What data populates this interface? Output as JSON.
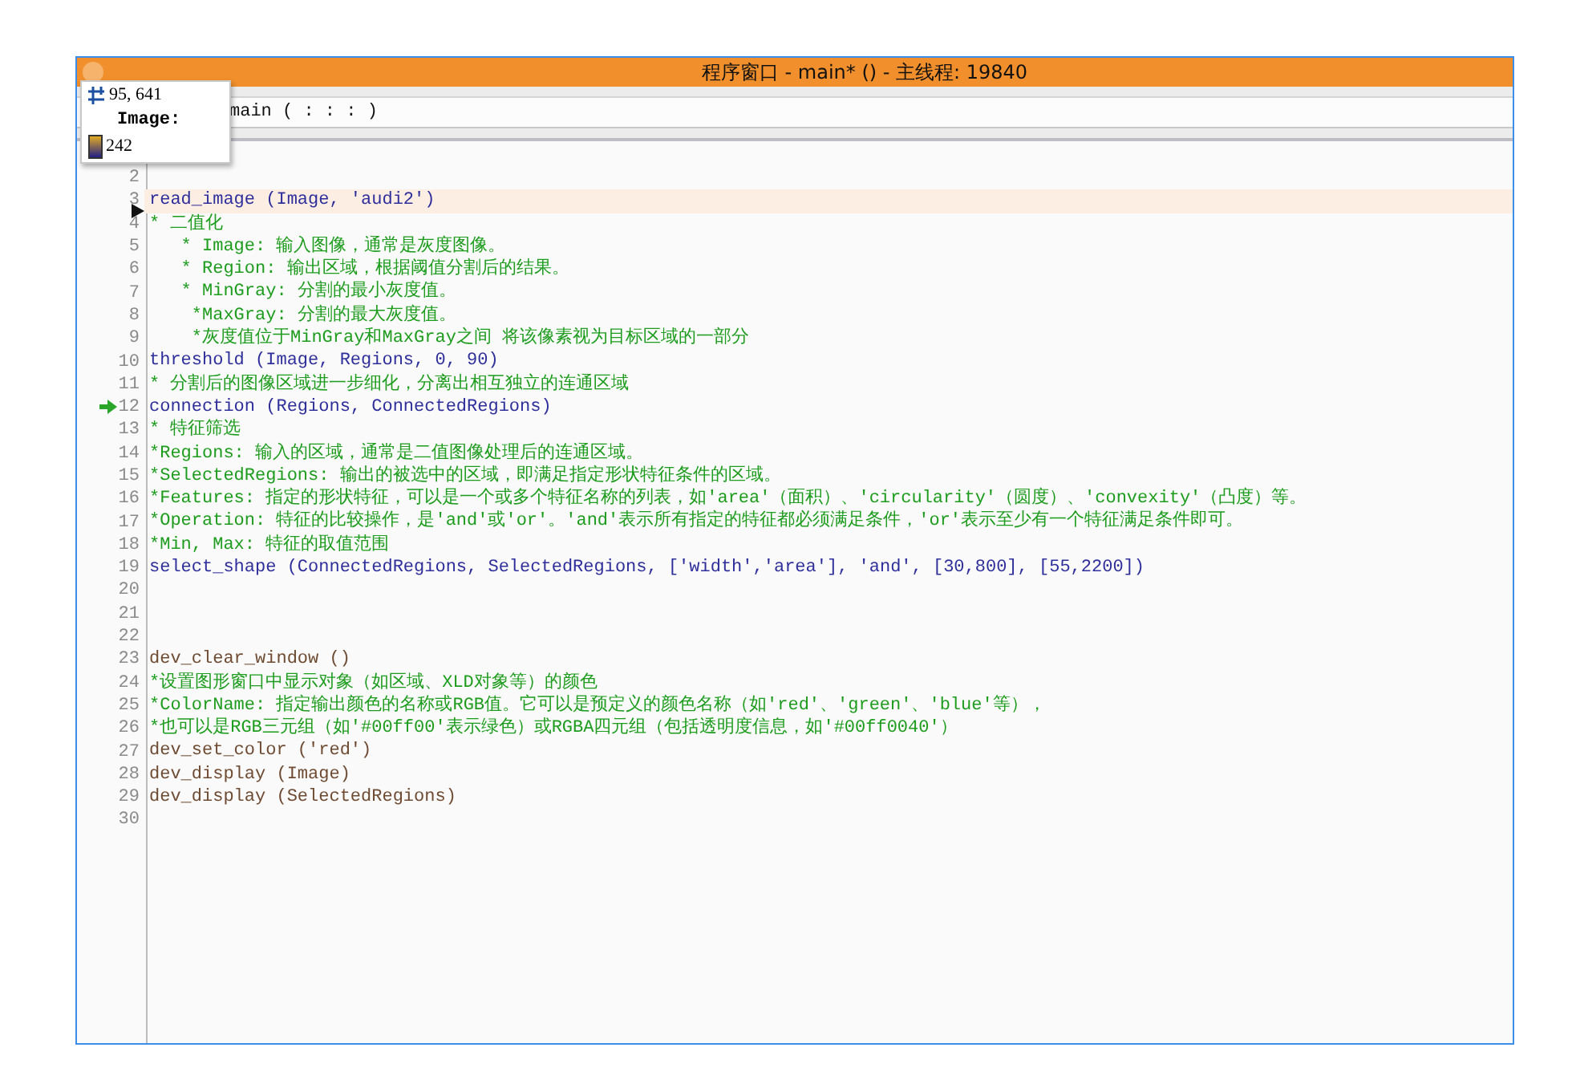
{
  "window": {
    "title": "程序窗口 - main* () - 主线程: 19840"
  },
  "procedure_header": "main ( : : : )",
  "tooltip": {
    "coords": "95, 641",
    "label": "Image:",
    "value": "242"
  },
  "lines": [
    {
      "number": "2",
      "kind": "code",
      "current": false
    },
    {
      "number": "3",
      "text": "read_image (Image, 'audi2')",
      "kind": "code",
      "current": true,
      "insert_cursor": true
    },
    {
      "number": "4",
      "text": "* 二值化",
      "kind": "comment",
      "current": false
    },
    {
      "number": "5",
      "text": "   * Image: 输入图像，通常是灰度图像。",
      "kind": "comment",
      "current": false
    },
    {
      "number": "6",
      "text": "   * Region: 输出区域，根据阈值分割后的结果。",
      "kind": "comment",
      "current": false
    },
    {
      "number": "7",
      "text": "   * MinGray: 分割的最小灰度值。",
      "kind": "comment",
      "current": false
    },
    {
      "number": "8",
      "text": "    *MaxGray: 分割的最大灰度值。",
      "kind": "comment",
      "current": false
    },
    {
      "number": "9",
      "text": "    *灰度值位于MinGray和MaxGray之间 将该像素视为目标区域的一部分",
      "kind": "comment",
      "current": false
    },
    {
      "number": "10",
      "text": "threshold (Image, Regions, 0, 90)",
      "kind": "code",
      "current": false
    },
    {
      "number": "11",
      "text": "* 分割后的图像区域进一步细化，分离出相互独立的连通区域",
      "kind": "comment",
      "current": false
    },
    {
      "number": "12",
      "text": "connection (Regions, ConnectedRegions)",
      "kind": "code",
      "current": false,
      "program_counter": true
    },
    {
      "number": "13",
      "text": "* 特征筛选",
      "kind": "comment",
      "current": false
    },
    {
      "number": "14",
      "text": "*Regions: 输入的区域，通常是二值图像处理后的连通区域。",
      "kind": "comment",
      "current": false
    },
    {
      "number": "15",
      "text": "*SelectedRegions: 输出的被选中的区域，即满足指定形状特征条件的区域。",
      "kind": "comment",
      "current": false
    },
    {
      "number": "16",
      "text": "*Features: 指定的形状特征，可以是一个或多个特征名称的列表，如'area'（面积）、'circularity'（圆度）、'convexity'（凸度）等。",
      "kind": "comment",
      "current": false
    },
    {
      "number": "17",
      "text": "*Operation: 特征的比较操作，是'and'或'or'。'and'表示所有指定的特征都必须满足条件，'or'表示至少有一个特征满足条件即可。",
      "kind": "comment",
      "current": false
    },
    {
      "number": "18",
      "text": "*Min, Max: 特征的取值范围",
      "kind": "comment",
      "current": false
    },
    {
      "number": "19",
      "text": "select_shape (ConnectedRegions, SelectedRegions, ['width','area'], 'and', [30,800], [55,2200])",
      "kind": "code",
      "current": false
    },
    {
      "number": "20",
      "kind": "code",
      "current": false
    },
    {
      "number": "21",
      "kind": "code",
      "current": false
    },
    {
      "number": "22",
      "kind": "code",
      "current": false
    },
    {
      "number": "23",
      "text": "dev_clear_window ()",
      "kind": "dev",
      "current": false
    },
    {
      "number": "24",
      "text": "*设置图形窗口中显示对象（如区域、XLD对象等）的颜色",
      "kind": "comment",
      "current": false
    },
    {
      "number": "25",
      "text": "*ColorName: 指定输出颜色的名称或RGB值。它可以是预定义的颜色名称（如'red'、'green'、'blue'等），",
      "kind": "comment",
      "current": false
    },
    {
      "number": "26",
      "text": "*也可以是RGB三元组（如'#00ff00'表示绿色）或RGBA四元组（包括透明度信息，如'#00ff0040'）",
      "kind": "comment",
      "current": false
    },
    {
      "number": "27",
      "text": "dev_set_color ('red')",
      "kind": "dev",
      "current": false
    },
    {
      "number": "28",
      "text": "dev_display (Image)",
      "kind": "dev",
      "current": false
    },
    {
      "number": "29",
      "text": "dev_display (SelectedRegions)",
      "kind": "dev",
      "current": false
    },
    {
      "number": "30",
      "kind": "code",
      "current": false
    }
  ]
}
